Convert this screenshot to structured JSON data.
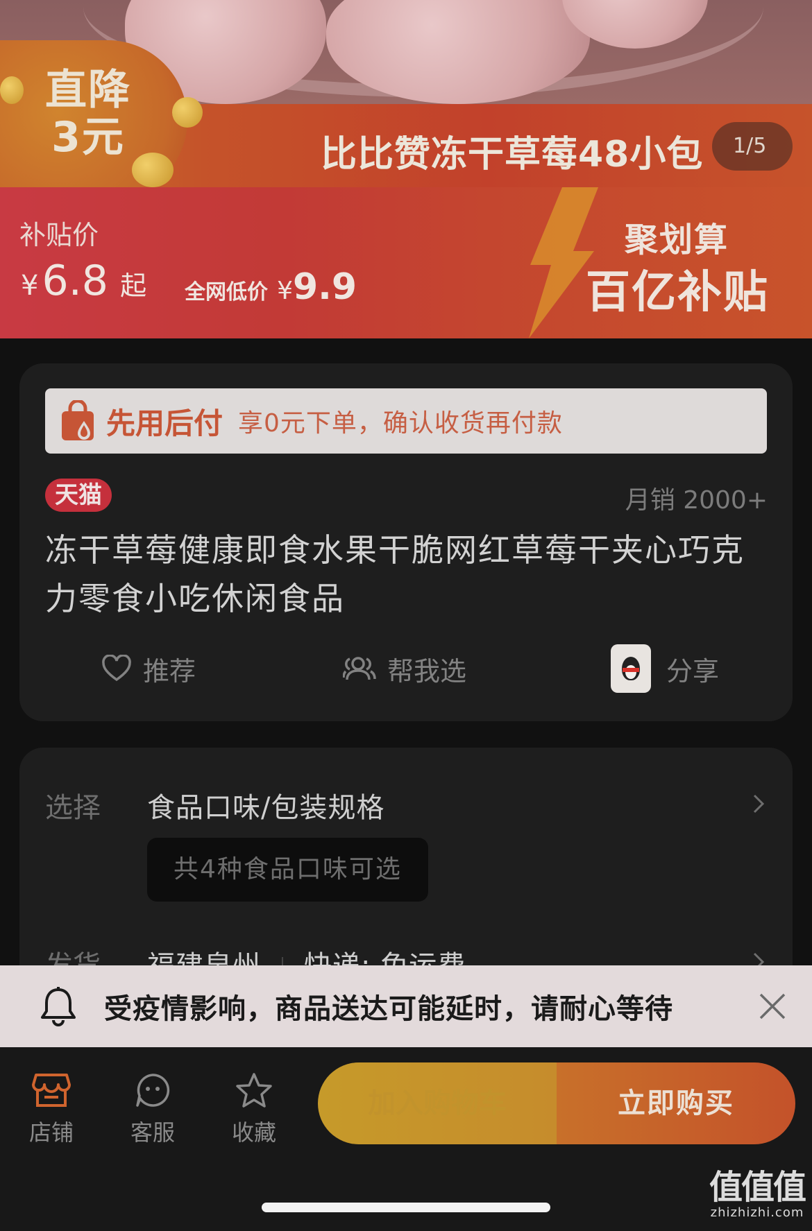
{
  "hero": {
    "badge_line1": "直降",
    "badge_line2": "3元",
    "title": "比比赞冻干草莓48小包",
    "pager": "1/5"
  },
  "price": {
    "subsidy_label": "补贴价",
    "currency": "¥",
    "main_price": "6.8",
    "from_suffix": "起",
    "low_label": "全网低价",
    "low_price": "9.9",
    "promo_title": "聚划算",
    "promo_subtitle": "百亿补贴"
  },
  "pay_later": {
    "title": "先用后付",
    "desc": "享0元下单，确认收货再付款"
  },
  "product": {
    "badge": "天猫",
    "sales": "月销 2000+",
    "title": "冻干草莓健康即食水果干脆网红草莓干夹心巧克力零食小吃休闲食品"
  },
  "actions": {
    "recommend": "推荐",
    "help_choose": "帮我选",
    "share": "分享"
  },
  "options": {
    "select_label": "选择",
    "select_value": "食品口味/包装规格",
    "flavor_chip": "共4种食品口味可选",
    "ship_label": "发货",
    "ship_origin": "福建泉州",
    "ship_fee": "快递: 免运费"
  },
  "notice": {
    "text": "受疫情影响，商品送达可能延时，请耐心等待"
  },
  "bottom": {
    "shop": "店铺",
    "service": "客服",
    "favorite": "收藏",
    "add_cart": "加入购物车",
    "buy_now": "立即购买"
  },
  "watermark": {
    "logo": "值值值",
    "url": "zhizhizhi.com"
  },
  "colors": {
    "accent_orange": "#c65536",
    "tmall_red": "#c5303c",
    "buy_orange": "#c4522a"
  }
}
